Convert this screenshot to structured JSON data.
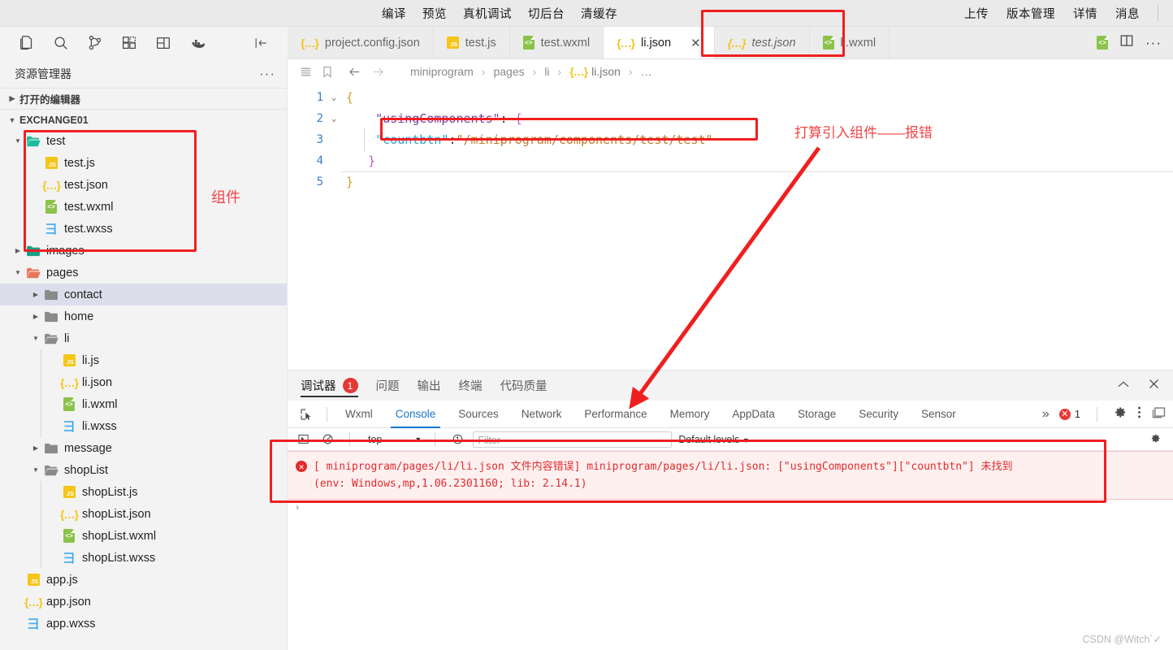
{
  "titlebar": {
    "center_menu": [
      "编译",
      "预览",
      "真机调试",
      "切后台",
      "清缓存"
    ],
    "right_menu": [
      "上传",
      "版本管理",
      "详情",
      "消息"
    ]
  },
  "activitybar": {
    "icons": [
      "files-icon",
      "search-icon",
      "source-control-icon",
      "extensions-icon",
      "layout-icon",
      "docker-icon"
    ],
    "collapse_icon": "collapse-all-icon"
  },
  "sidebar": {
    "title": "资源管理器",
    "more_label": "···",
    "open_editors_label": "打开的编辑器",
    "workspace_label": "EXCHANGE01",
    "tree": [
      {
        "label": "test",
        "type": "folder-open",
        "depth": 1,
        "expanded": true
      },
      {
        "label": "test.js",
        "type": "js",
        "depth": 2
      },
      {
        "label": "test.json",
        "type": "json",
        "depth": 2
      },
      {
        "label": "test.wxml",
        "type": "wxml",
        "depth": 2
      },
      {
        "label": "test.wxss",
        "type": "wxss",
        "depth": 2
      },
      {
        "label": "images",
        "type": "folder-img",
        "depth": 1,
        "expanded": false
      },
      {
        "label": "pages",
        "type": "folder-pages",
        "depth": 1,
        "expanded": true
      },
      {
        "label": "contact",
        "type": "folder",
        "depth": 2,
        "expanded": false,
        "selected": true
      },
      {
        "label": "home",
        "type": "folder",
        "depth": 2,
        "expanded": false
      },
      {
        "label": "li",
        "type": "folder-open-plain",
        "depth": 2,
        "expanded": true
      },
      {
        "label": "li.js",
        "type": "js",
        "depth": 3
      },
      {
        "label": "li.json",
        "type": "json",
        "depth": 3
      },
      {
        "label": "li.wxml",
        "type": "wxml",
        "depth": 3
      },
      {
        "label": "li.wxss",
        "type": "wxss",
        "depth": 3
      },
      {
        "label": "message",
        "type": "folder",
        "depth": 2,
        "expanded": false
      },
      {
        "label": "shopList",
        "type": "folder-open-plain",
        "depth": 2,
        "expanded": true
      },
      {
        "label": "shopList.js",
        "type": "js",
        "depth": 3
      },
      {
        "label": "shopList.json",
        "type": "json",
        "depth": 3
      },
      {
        "label": "shopList.wxml",
        "type": "wxml",
        "depth": 3
      },
      {
        "label": "shopList.wxss",
        "type": "wxss",
        "depth": 3
      },
      {
        "label": "app.js",
        "type": "js",
        "depth": 1
      },
      {
        "label": "app.json",
        "type": "json",
        "depth": 1
      },
      {
        "label": "app.wxss",
        "type": "wxss",
        "depth": 1
      }
    ]
  },
  "tabs": [
    {
      "label": "project.config.json",
      "icon": "json",
      "active": false,
      "italic": false
    },
    {
      "label": "test.js",
      "icon": "js",
      "active": false,
      "italic": false
    },
    {
      "label": "test.wxml",
      "icon": "wxml",
      "active": false,
      "italic": false
    },
    {
      "label": "li.json",
      "icon": "json",
      "active": true,
      "italic": false,
      "close": "✕"
    },
    {
      "label": "test.json",
      "icon": "json",
      "active": false,
      "italic": true
    },
    {
      "label": "li.wxml",
      "icon": "wxml",
      "active": false,
      "italic": false
    }
  ],
  "tabbar_actions": {
    "split_icon": "split-editor-icon",
    "more_icon": "more-actions-icon",
    "file_icon": "wxml"
  },
  "breadcrumb": {
    "segments": [
      "miniprogram",
      "pages",
      "li"
    ],
    "current_file": "li.json",
    "trailing": "…",
    "separator": "›",
    "icons": [
      "outline-icon",
      "bookmark-icon",
      "back-icon",
      "forward-icon"
    ]
  },
  "code": {
    "lines": [
      {
        "n": "1",
        "fold": "⌄"
      },
      {
        "n": "2",
        "fold": "⌄"
      },
      {
        "n": "3",
        "fold": ""
      },
      {
        "n": "4",
        "fold": ""
      },
      {
        "n": "5",
        "fold": ""
      }
    ],
    "l1_brace": "{",
    "l2_key": "\"usingComponents\"",
    "l2_colon": ":",
    "l2_brace": "{",
    "l3_key": "\"countbtn\"",
    "l3_colon": ":",
    "l3_value": "\"/miniprogram/components/test/test\"",
    "l4_brace": "}",
    "l5_brace": "}"
  },
  "panel": {
    "tabs": [
      {
        "label": "调试器",
        "active": true,
        "badge": "1"
      },
      {
        "label": "问题",
        "active": false
      },
      {
        "label": "输出",
        "active": false
      },
      {
        "label": "终端",
        "active": false
      },
      {
        "label": "代码质量",
        "active": false
      }
    ],
    "chevron_up": "⌃",
    "close": "✕"
  },
  "devtools": {
    "inspect_icon": "inspect-element-icon",
    "tabs": [
      "Wxml",
      "Console",
      "Sources",
      "Network",
      "Performance",
      "Memory",
      "AppData",
      "Storage",
      "Security",
      "Sensor"
    ],
    "active_tab": "Console",
    "overflow": "»",
    "error_count": "1",
    "settings_icon": "gear-icon",
    "kebab_icon": "more-vertical-icon",
    "dock_icon": "dock-side-icon"
  },
  "console_filterbar": {
    "exec_icon": "execution-context-icon",
    "clear_icon": "clear-console-icon",
    "context": "top",
    "context_caret": "▼",
    "eye_icon": "live-expression-icon",
    "filter_placeholder": "Filter",
    "levels": "Default levels",
    "levels_caret": "▼",
    "gear_icon": "gear-icon"
  },
  "console": {
    "error_line1": "[ miniprogram/pages/li/li.json 文件内容错误] miniprogram/pages/li/li.json: [\"usingComponents\"][\"countbtn\"] 未找到",
    "error_line2": "(env: Windows,mp,1.06.2301160; lib: 2.14.1)",
    "prompt": "›"
  },
  "annotations": {
    "component_label": "组件",
    "intro_label": "打算引入组件——报错",
    "box_color": "#f01f1f",
    "text_color": "#f24444"
  },
  "watermark": "CSDN @Witch`✓"
}
